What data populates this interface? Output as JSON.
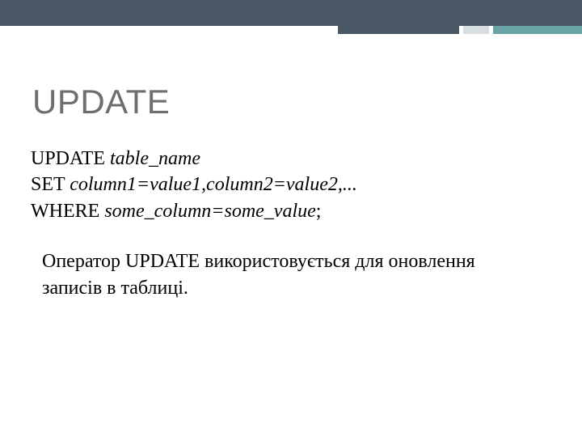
{
  "slide": {
    "title": "UPDATE",
    "code": {
      "line1": {
        "kw": "UPDATE ",
        "arg": "table_name"
      },
      "line2": {
        "kw": "SET ",
        "arg": "column1=value1,column2=value2,..."
      },
      "line3": {
        "kw": "WHERE ",
        "arg": "some_column=some_value",
        "tail": ";"
      }
    },
    "description": "Оператор UPDATE використовується для оновлення записів в таблиці."
  }
}
